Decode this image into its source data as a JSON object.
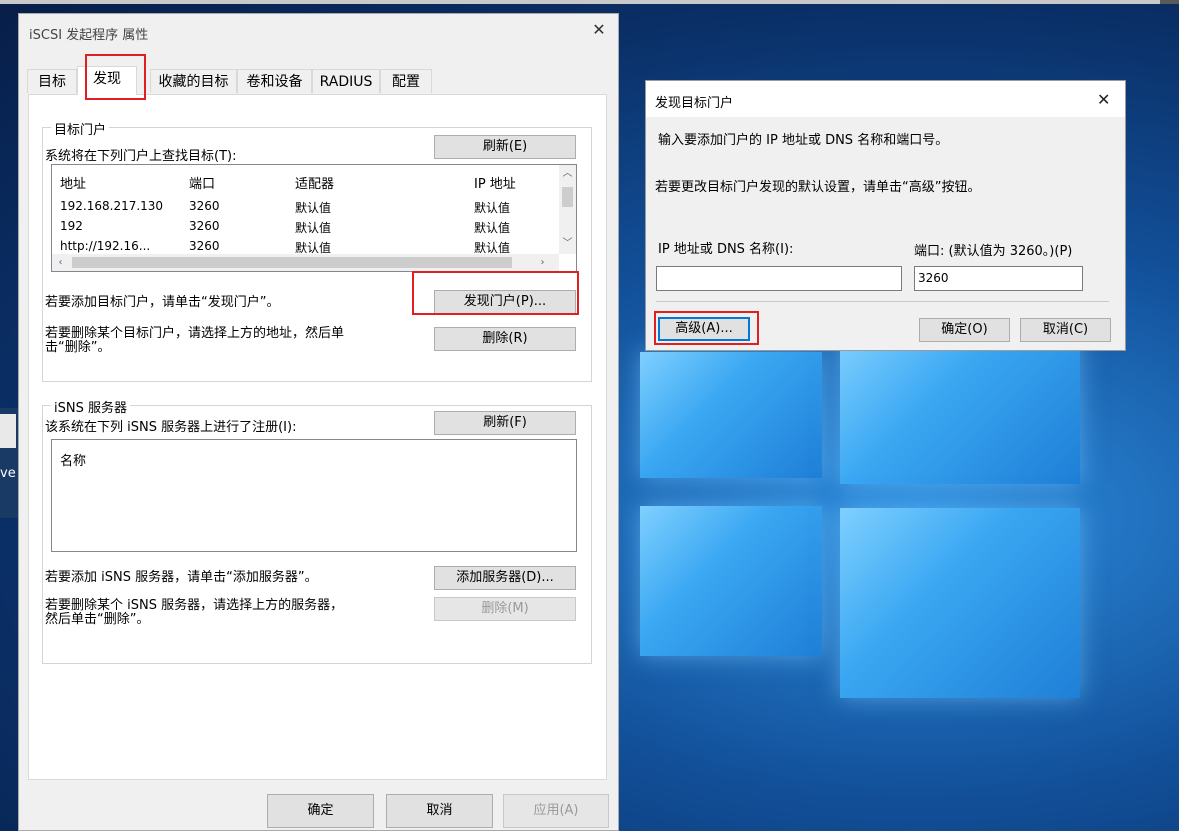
{
  "desktop": {
    "left_partial_text": "ve"
  },
  "main_dialog": {
    "title": "iSCSI 发起程序 属性",
    "tabs": [
      {
        "label": "目标"
      },
      {
        "label": "发现"
      },
      {
        "label": "收藏的目标"
      },
      {
        "label": "卷和设备"
      },
      {
        "label": "RADIUS"
      },
      {
        "label": "配置"
      }
    ],
    "target_portals": {
      "group_title": "目标门户",
      "refresh_button": "刷新(E)",
      "list_caption": "系统将在下列门户上查找目标(T):",
      "columns": [
        "地址",
        "端口",
        "适配器",
        "IP 地址"
      ],
      "rows": [
        [
          "192.168.217.130",
          "3260",
          "默认值",
          "默认值"
        ],
        [
          "192",
          "3260",
          "默认值",
          "默认值"
        ],
        [
          "http://192.16...",
          "3260",
          "默认值",
          "默认值"
        ]
      ],
      "add_hint": "若要添加目标门户，请单击“发现门户”。",
      "discover_button": "发现门户(P)...",
      "remove_hint_line1": "若要删除某个目标门户，请选择上方的地址，然后单",
      "remove_hint_line2": "击“删除”。",
      "remove_button": "删除(R)"
    },
    "isns": {
      "group_title": "iSNS 服务器",
      "refresh_button": "刷新(F)",
      "list_caption": "该系统在下列 iSNS 服务器上进行了注册(I):",
      "column": "名称",
      "add_hint": "若要添加 iSNS 服务器，请单击“添加服务器”。",
      "add_button": "添加服务器(D)...",
      "remove_hint_line1": "若要删除某个 iSNS 服务器，请选择上方的服务器，",
      "remove_hint_line2": "然后单击“删除”。",
      "remove_button": "删除(M)"
    },
    "footer": {
      "ok": "确定",
      "cancel": "取消",
      "apply": "应用(A)"
    }
  },
  "discover_dialog": {
    "title": "发现目标门户",
    "instruction": "输入要添加门户的 IP 地址或 DNS 名称和端口号。",
    "advanced_hint": "若要更改目标门户发现的默认设置，请单击“高级”按钮。",
    "ip_label": "IP 地址或 DNS 名称(I):",
    "ip_value": "",
    "port_label": "端口: (默认值为 3260。)(P)",
    "port_value": "3260",
    "advanced_button": "高级(A)...",
    "ok_button": "确定(O)",
    "cancel_button": "取消(C)"
  },
  "colors": {
    "highlight": "#e02020",
    "focus_blue": "#0078d7",
    "dialog_bg": "#f0f0f0"
  }
}
